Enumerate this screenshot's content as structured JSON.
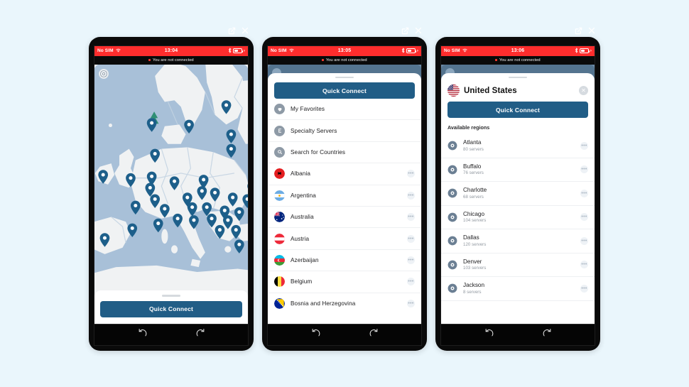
{
  "page": {
    "background_color": "#eaf6fc",
    "accent_color": "#215d86",
    "status_bar_color": "#ff2d2d"
  },
  "window_controls": {
    "popout_label": "open-in-new-window",
    "close_label": "close"
  },
  "phones": [
    {
      "id": "phone-map",
      "status_bar": {
        "carrier": "No SIM",
        "time": "13:04",
        "wifi": "wifi-icon",
        "bluetooth": "bluetooth-icon",
        "battery": "battery-icon"
      },
      "banner": {
        "text": "You are not connected"
      },
      "screen_type": "map",
      "map": {
        "gear_label": "settings-gear",
        "pin_count": 38,
        "water_color": "#a8c0d8",
        "land_color": "#f0f2f3",
        "pin_color": "#1d5f8a"
      },
      "quick_connect": {
        "label": "Quick Connect"
      }
    },
    {
      "id": "phone-countries",
      "status_bar": {
        "carrier": "No SIM",
        "time": "13:05",
        "wifi": "wifi-icon",
        "bluetooth": "bluetooth-icon",
        "battery": "battery-icon"
      },
      "banner": {
        "text": "You are not connected"
      },
      "screen_type": "country-list",
      "quick_connect": {
        "label": "Quick Connect"
      },
      "utility_rows": [
        {
          "label": "My Favorites",
          "icon": "heart-icon"
        },
        {
          "label": "Specialty Servers",
          "icon": "specialty-servers-icon"
        },
        {
          "label": "Search for Countries",
          "icon": "search-icon"
        }
      ],
      "countries": [
        {
          "label": "Albania",
          "flag": "flag-albania",
          "more": "•••"
        },
        {
          "label": "Argentina",
          "flag": "flag-argentina",
          "more": "•••"
        },
        {
          "label": "Australia",
          "flag": "flag-australia",
          "more": "•••"
        },
        {
          "label": "Austria",
          "flag": "flag-austria",
          "more": "•••"
        },
        {
          "label": "Azerbaijan",
          "flag": "flag-azerbaijan",
          "more": "•••"
        },
        {
          "label": "Belgium",
          "flag": "flag-belgium",
          "more": "•••"
        },
        {
          "label": "Bosnia and Herzegovina",
          "flag": "flag-bosnia",
          "more": "•••"
        }
      ]
    },
    {
      "id": "phone-united-states",
      "status_bar": {
        "carrier": "No SIM",
        "time": "13:06",
        "wifi": "wifi-icon",
        "bluetooth": "bluetooth-icon",
        "battery": "battery-icon"
      },
      "banner": {
        "text": "You are not connected"
      },
      "screen_type": "country-detail",
      "detail": {
        "title": "United States",
        "flag": "flag-united-states",
        "close_label": "✕",
        "quick_connect": {
          "label": "Quick Connect"
        },
        "section_label": "Available regions",
        "regions": [
          {
            "name": "Atlanta",
            "servers": "80 servers",
            "more": "•••"
          },
          {
            "name": "Buffalo",
            "servers": "76 servers",
            "more": "•••"
          },
          {
            "name": "Charlotte",
            "servers": "68 servers",
            "more": "•••"
          },
          {
            "name": "Chicago",
            "servers": "104 servers",
            "more": "•••"
          },
          {
            "name": "Dallas",
            "servers": "120 servers",
            "more": "•••"
          },
          {
            "name": "Denver",
            "servers": "103 servers",
            "more": "•••"
          },
          {
            "name": "Jackson",
            "servers": "8 servers",
            "more": "•••"
          }
        ]
      }
    }
  ],
  "nav": {
    "back_label": "back",
    "forward_label": "forward"
  }
}
